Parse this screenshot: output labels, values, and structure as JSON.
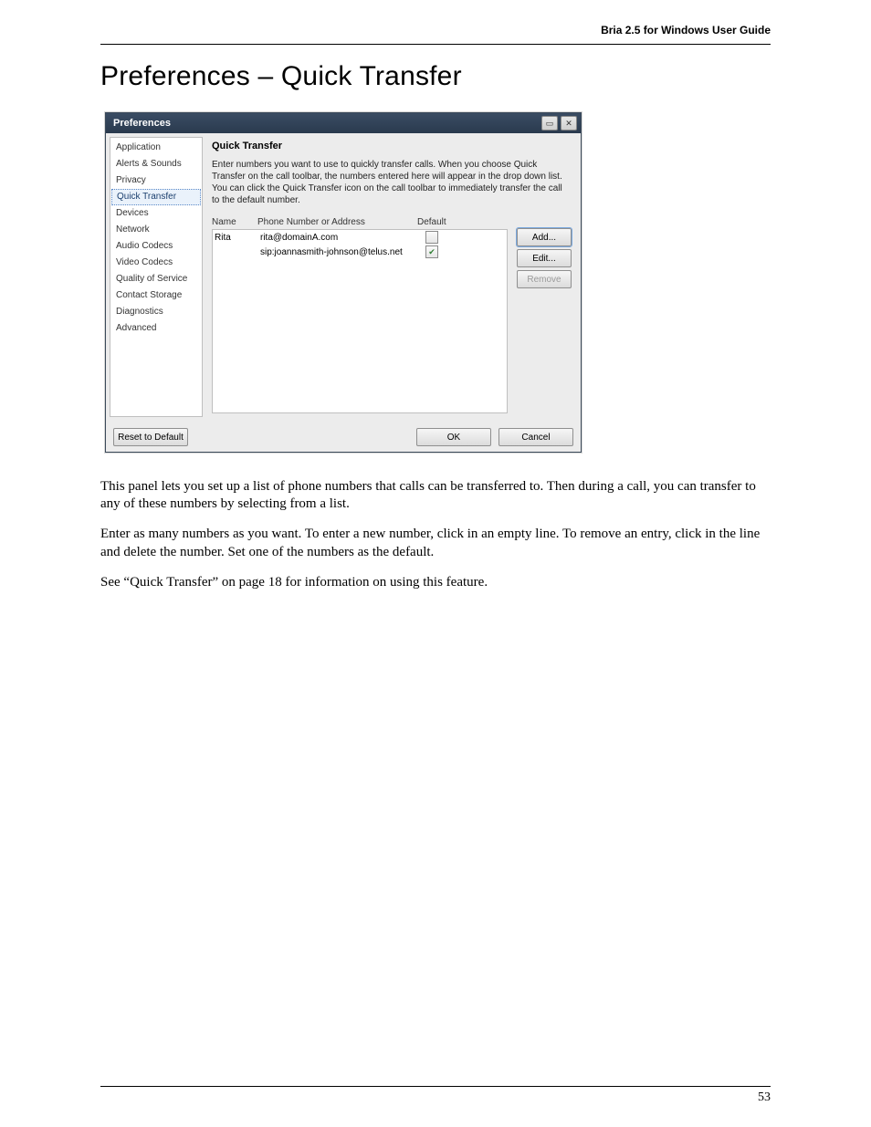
{
  "doc_header": "Bria 2.5 for Windows User Guide",
  "heading": "Preferences – Quick Transfer",
  "dialog": {
    "title": "Preferences",
    "sidebar": {
      "items": [
        "Application",
        "Alerts & Sounds",
        "Privacy",
        "Quick Transfer",
        "Devices",
        "Network",
        "Audio Codecs",
        "Video Codecs",
        "Quality of Service",
        "Contact Storage",
        "Diagnostics",
        "Advanced"
      ],
      "selected_index": 3
    },
    "panel_title": "Quick Transfer",
    "panel_desc": "Enter numbers you want to use to quickly transfer calls. When you choose Quick Transfer on the call toolbar, the numbers entered here will appear in the drop down list. You can click the Quick Transfer icon on the call toolbar to immediately transfer the call to the default number.",
    "columns": {
      "name": "Name",
      "addr": "Phone Number or Address",
      "def": "Default"
    },
    "rows": [
      {
        "name": "Rita",
        "addr": "rita@domainA.com",
        "default": false
      },
      {
        "name": "",
        "addr": "sip:joannasmith-johnson@telus.net",
        "default": true
      }
    ],
    "buttons": {
      "add": "Add...",
      "edit": "Edit...",
      "remove": "Remove",
      "reset": "Reset to Default",
      "ok": "OK",
      "cancel": "Cancel"
    }
  },
  "body": {
    "p1": "This panel lets you set up a list of phone numbers that calls can be transferred to. Then during a call, you can transfer to any of these numbers by selecting from a list.",
    "p2": "Enter as many numbers as you want. To enter a new number, click in an empty line. To remove an entry, click in the line and delete the number. Set one of the numbers as the default.",
    "p3": "See “Quick Transfer” on page 18 for information on using this feature."
  },
  "page_number": "53"
}
